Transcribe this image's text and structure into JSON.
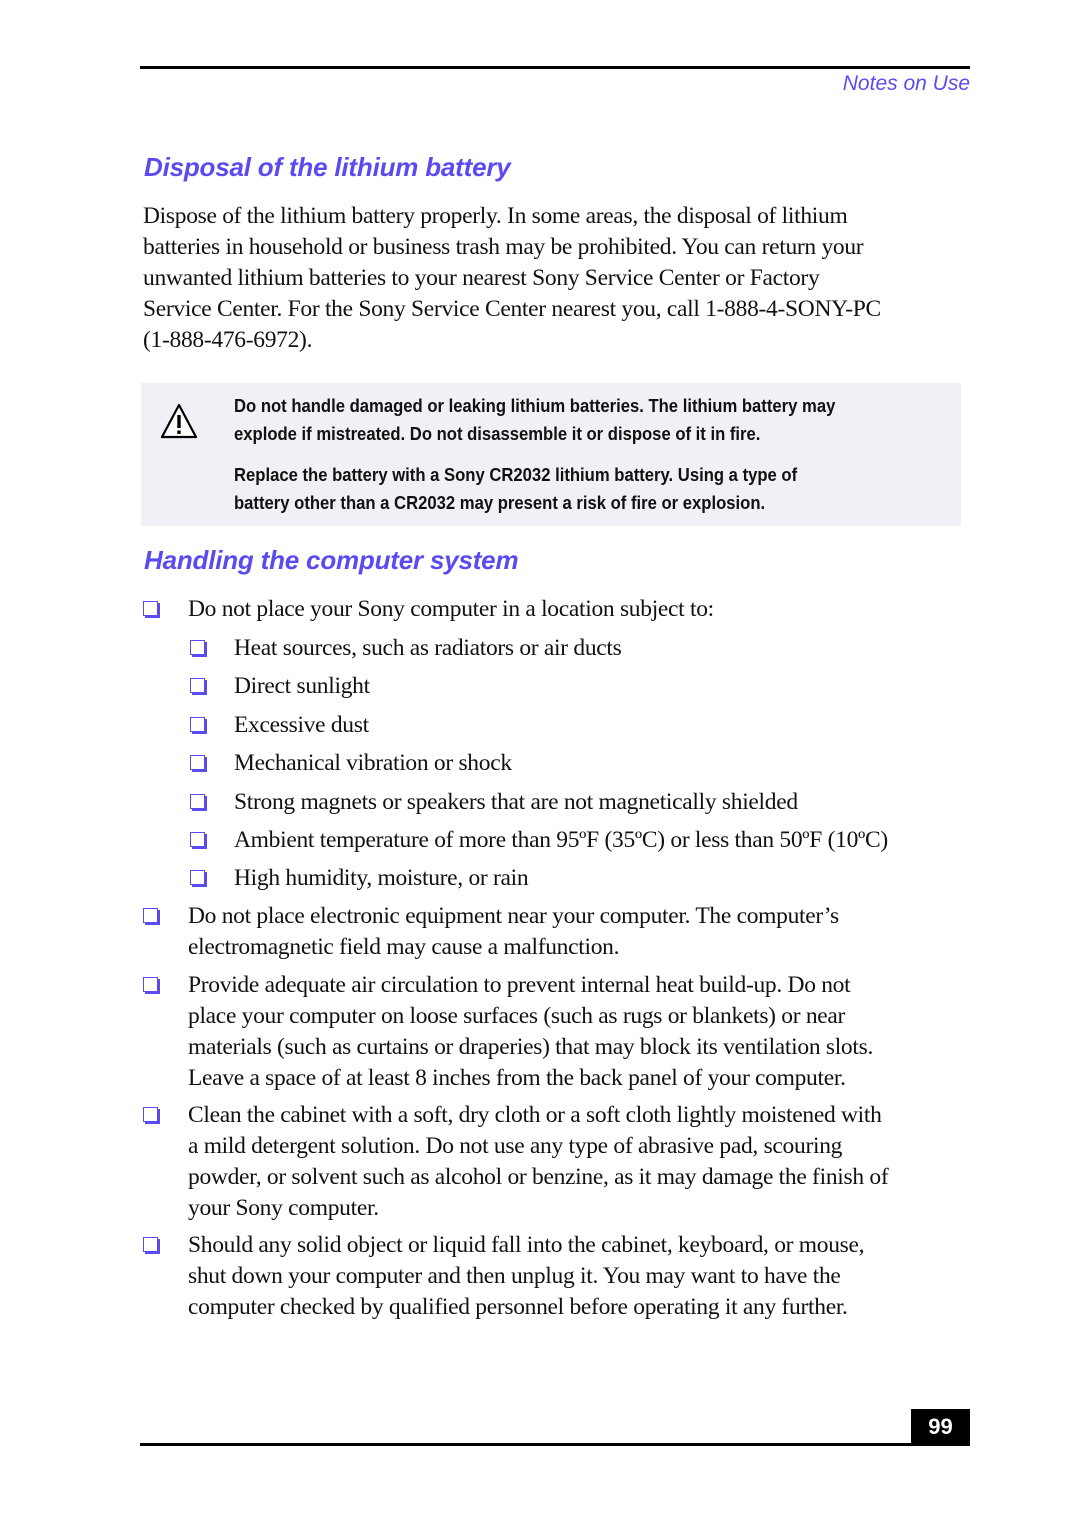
{
  "header": {
    "running_head": "Notes on Use"
  },
  "section1": {
    "title": "Disposal of the lithium battery",
    "paragraph_lines": [
      "Dispose of the lithium battery properly. In some areas, the disposal of lithium",
      "batteries in household or business trash may be prohibited. You can return your",
      "unwanted lithium batteries to your nearest Sony Service Center or Factory",
      "Service Center. For the Sony Service Center nearest you, call 1-888-4-SONY-PC",
      "(1-888-476-6972)."
    ],
    "warning": {
      "icon": "warning-triangle-icon",
      "lines": [
        "Do not handle damaged or leaking lithium batteries. The lithium battery may",
        "explode if mistreated. Do not disassemble it or dispose of it in fire.",
        "Replace the battery with a Sony CR2032 lithium battery. Using a type of",
        "battery other than a CR2032 may present a risk of fire or explosion."
      ]
    }
  },
  "section2": {
    "title": "Handling the computer system",
    "intro": "Do not place your Sony computer in a location subject to:",
    "subitems": [
      "Heat sources, such as radiators or air ducts",
      "Direct sunlight",
      "Excessive dust",
      "Mechanical vibration or shock",
      "Strong magnets or speakers that are not magnetically shielded",
      "Ambient temperature of more than 95ºF (35ºC) or less than 50ºF (10ºC)",
      "High humidity, moisture, or rain"
    ],
    "items": [
      [
        "Do not place electronic equipment near your computer. The computer’s",
        "electromagnetic field may cause a malfunction."
      ],
      [
        "Provide adequate air circulation to prevent internal heat build-up. Do not",
        "place your computer on loose surfaces (such as rugs or blankets) or near",
        "materials (such as curtains or draperies) that may block its ventilation slots.",
        "Leave a space of at least 8 inches from the back panel of your computer."
      ],
      [
        "Clean the cabinet with a soft, dry cloth or a soft cloth lightly moistened with",
        "a mild detergent solution. Do not use any type of abrasive pad, scouring",
        "powder, or solvent such as alcohol or benzine, as it may damage the finish of",
        "your Sony computer."
      ],
      [
        "Should any solid object or liquid fall into the cabinet, keyboard, or mouse,",
        "shut down your computer and then unplug it. You may want to have the",
        "computer checked by qualified personnel before operating it any further."
      ]
    ]
  },
  "footer": {
    "page_number": "99"
  },
  "colors": {
    "accent": "#5a4bf0",
    "note_bg": "#f0f0f7"
  }
}
